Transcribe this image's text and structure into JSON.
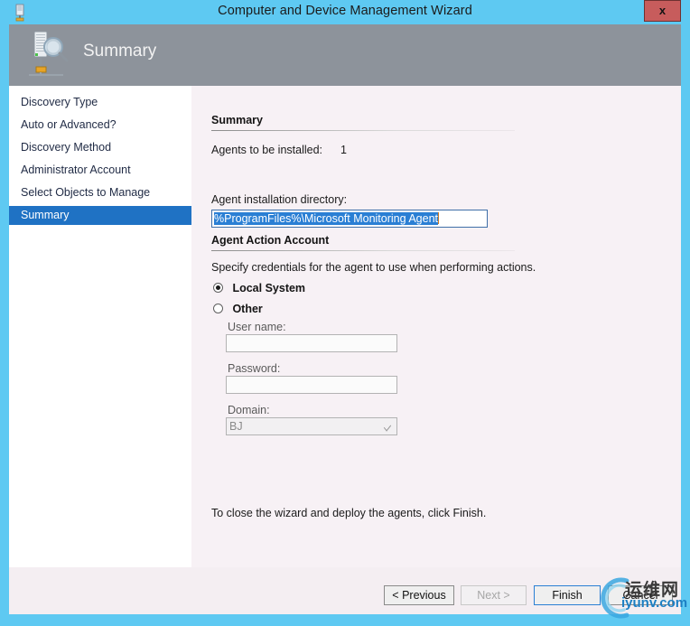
{
  "window": {
    "title": "Computer and Device Management Wizard",
    "titlebar_icon": "server-icon",
    "close_label": "x",
    "accent_color": "#5ec9f2",
    "banner_color": "#8d939b",
    "content_bg": "#f7f1f5"
  },
  "banner": {
    "title": "Summary",
    "icon": "server-discovery-icon"
  },
  "sidebar": {
    "items": [
      {
        "label": "Discovery Type",
        "active": false
      },
      {
        "label": "Auto or Advanced?",
        "active": false
      },
      {
        "label": "Discovery Method",
        "active": false
      },
      {
        "label": "Administrator Account",
        "active": false
      },
      {
        "label": "Select Objects to Manage",
        "active": false
      },
      {
        "label": "Summary",
        "active": true
      }
    ],
    "active_color": "#1f72c4"
  },
  "summary_section": {
    "heading": "Summary",
    "agents_label": "Agents to be installed:",
    "agents_count": "1",
    "directory_label": "Agent installation directory:",
    "directory_value": "%ProgramFiles%\\Microsoft Monitoring Agent",
    "directory_selected": true
  },
  "action_account_section": {
    "heading": "Agent Action Account",
    "description": "Specify credentials for the agent to use when performing actions.",
    "options": [
      {
        "label": "Local System",
        "checked": true
      },
      {
        "label": "Other",
        "checked": false
      }
    ],
    "fields": [
      {
        "label": "User name:",
        "value": "",
        "type": "text"
      },
      {
        "label": "Password:",
        "value": "",
        "type": "password"
      }
    ],
    "domain": {
      "label": "Domain:",
      "value": "BJ",
      "type": "select"
    }
  },
  "footer_note": "To close the wizard and deploy the agents, click Finish.",
  "buttons": [
    {
      "label": "< Previous",
      "state": "enabled"
    },
    {
      "label": "Next >",
      "state": "disabled"
    },
    {
      "label": "Finish",
      "state": "default"
    },
    {
      "label": "Cancel",
      "state": "enabled"
    }
  ],
  "watermark": {
    "text": "运维网",
    "url": "iyunv.com",
    "color": "#1b7fc4"
  }
}
